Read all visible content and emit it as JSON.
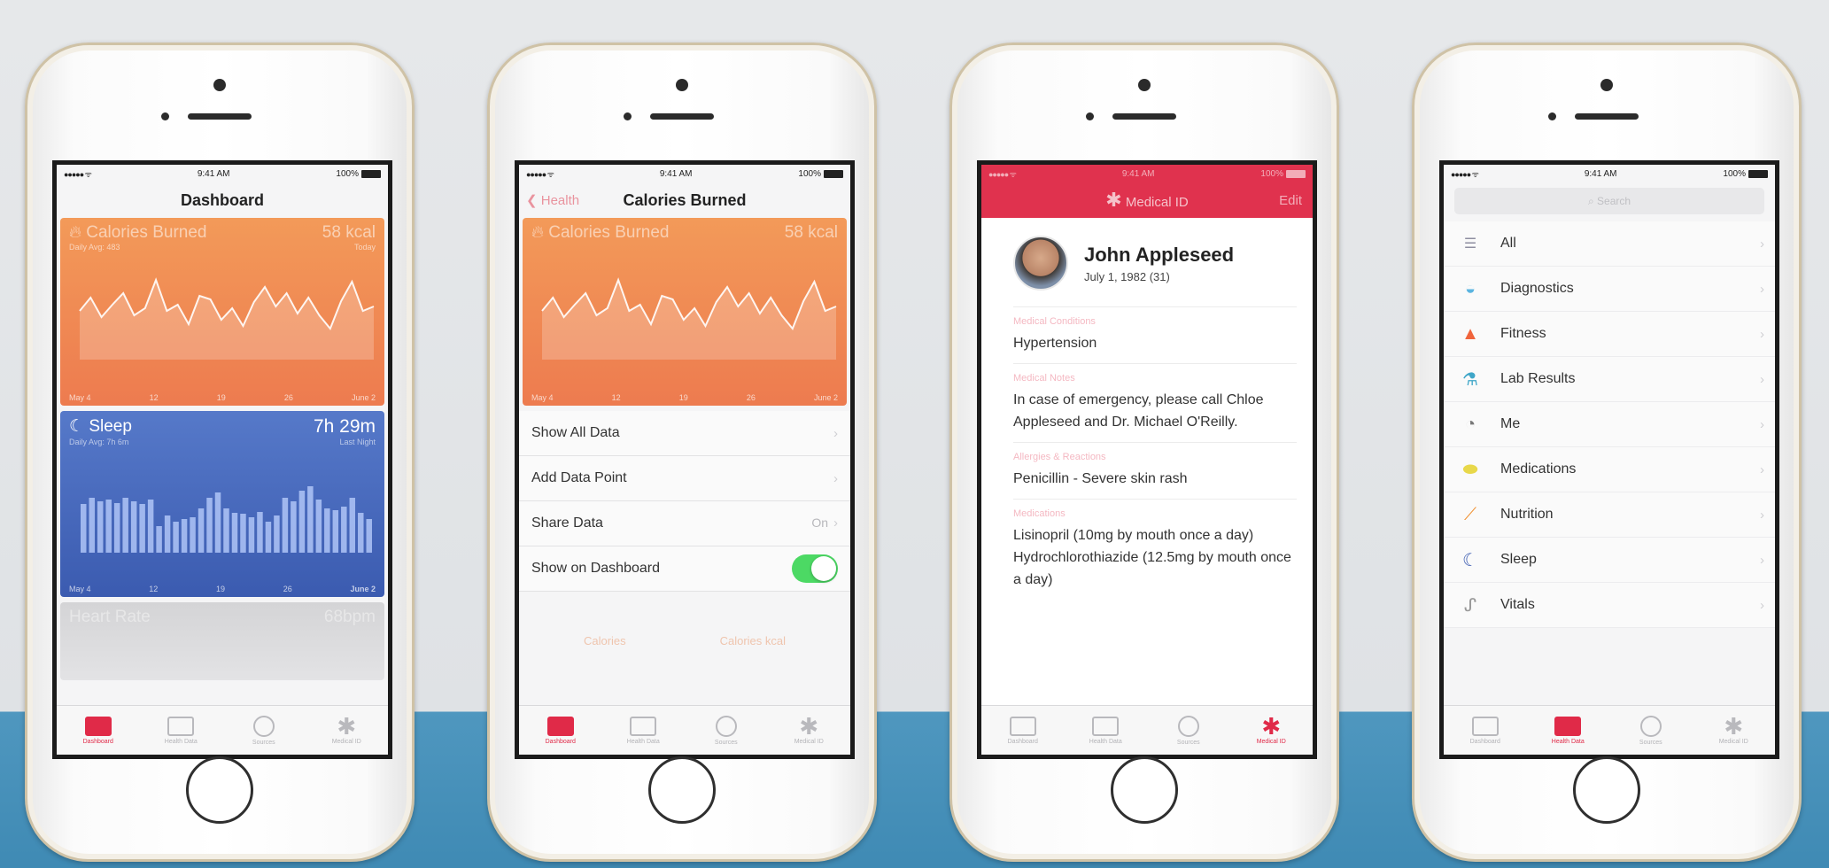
{
  "status": {
    "signal": "●●●●● ᯤ",
    "time": "9:41 AM",
    "battery": "100%"
  },
  "tabs": [
    "Dashboard",
    "Health Data",
    "Sources",
    "Medical ID"
  ],
  "phone1": {
    "title": "Dashboard",
    "calories": {
      "title": "Calories Burned",
      "value": "58 kcal",
      "sub_left": "Daily Avg: 483",
      "sub_right": "Today",
      "axis": [
        "May 4",
        "12",
        "19",
        "26",
        "June 2"
      ],
      "values": [
        0.55,
        0.7,
        0.48,
        0.62,
        0.75,
        0.5,
        0.58,
        0.9,
        0.55,
        0.62,
        0.4,
        0.72,
        0.68,
        0.45,
        0.58,
        0.38,
        0.65,
        0.82,
        0.6,
        0.75,
        0.52,
        0.7,
        0.5,
        0.35,
        0.66,
        0.88,
        0.55,
        0.6
      ]
    },
    "sleep": {
      "title": "Sleep",
      "value": "7h 29m",
      "sub_left": "Daily Avg: 7h 6m",
      "sub_right": "Last Night",
      "axis": [
        "May 4",
        "12",
        "19",
        "26",
        "June 2"
      ],
      "values": [
        0.55,
        0.62,
        0.58,
        0.6,
        0.56,
        0.62,
        0.58,
        0.55,
        0.6,
        0.3,
        0.42,
        0.35,
        0.38,
        0.4,
        0.5,
        0.62,
        0.68,
        0.5,
        0.45,
        0.44,
        0.4,
        0.46,
        0.35,
        0.42,
        0.62,
        0.58,
        0.7,
        0.75,
        0.6,
        0.5,
        0.48,
        0.52,
        0.62,
        0.45,
        0.38
      ]
    },
    "heart": {
      "title": "Heart Rate",
      "value": "68bpm"
    }
  },
  "phone2": {
    "back": "Health",
    "title": "Calories Burned",
    "card": {
      "title": "Calories Burned",
      "value": "58 kcal",
      "axis": [
        "May 4",
        "12",
        "19",
        "26",
        "June 2"
      ]
    },
    "rows": {
      "show_all": "Show All Data",
      "add_point": "Add Data Point",
      "share": "Share Data",
      "share_value": "On",
      "show_dashboard": "Show on Dashboard"
    },
    "units": [
      "Calories",
      "Calories kcal"
    ]
  },
  "phone3": {
    "title": "Medical ID",
    "edit": "Edit",
    "name": "John Appleseed",
    "dob": "July 1, 1982 (31)",
    "conditions_label": "Medical Conditions",
    "conditions": "Hypertension",
    "notes_label": "Medical Notes",
    "notes": "In case of emergency, please call Chloe Appleseed and Dr. Michael O'Reilly.",
    "allergies_label": "Allergies & Reactions",
    "allergies": "Penicillin - Severe skin rash",
    "medications_label": "Medications",
    "medications_1": "Lisinopril (10mg by mouth once a day)",
    "medications_2": "Hydrochlorothiazide (12.5mg by mouth once a day)"
  },
  "phone4": {
    "search_placeholder": "Search",
    "categories": [
      "All",
      "Diagnostics",
      "Fitness",
      "Lab Results",
      "Me",
      "Medications",
      "Nutrition",
      "Sleep",
      "Vitals"
    ]
  },
  "colors": {
    "health_red": "#e0324e",
    "calories_orange": "#ef8550",
    "sleep_blue": "#4567bd",
    "toggle_green": "#4cd964"
  }
}
